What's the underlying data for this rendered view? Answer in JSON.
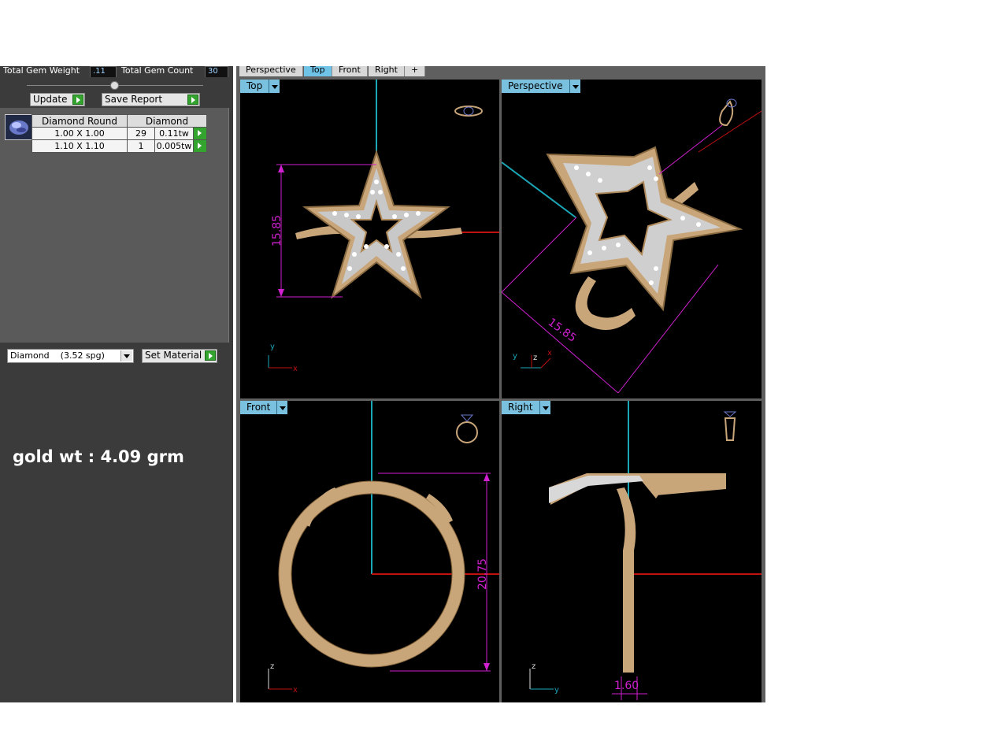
{
  "stats": {
    "total_gem_weight_label": "Total Gem Weight",
    "total_gem_weight_value": ".11",
    "total_gem_count_label": "Total Gem Count",
    "total_gem_count_value": "30"
  },
  "buttons": {
    "update": "Update",
    "save_report": "Save Report",
    "set_material": "Set Material"
  },
  "gem_table": {
    "headers": [
      "Diamond Round",
      "Diamond"
    ],
    "rows": [
      {
        "size": "1.00 X 1.00",
        "count": "29",
        "weight": "0.11tw"
      },
      {
        "size": "1.10 X 1.10",
        "count": "1",
        "weight": "0.005tw"
      }
    ]
  },
  "material_select": {
    "value": "Diamond    (3.52 spg)"
  },
  "note": "gold wt : 4.09 grm",
  "tabs": [
    "Perspective",
    "Top",
    "Front",
    "Right",
    "+"
  ],
  "active_tab": "Top",
  "viewports": {
    "top": {
      "label": "Top",
      "dimension": "15.85",
      "axis_1": "y",
      "axis_2": "x"
    },
    "perspective": {
      "label": "Perspective",
      "dimension": "15.85",
      "axis_1": "y",
      "axis_2": "z",
      "axis_3": "x"
    },
    "front": {
      "label": "Front",
      "dimension": "20.75",
      "axis_1": "z",
      "axis_2": "x"
    },
    "right": {
      "label": "Right",
      "dimension": "1.60",
      "axis_1": "z",
      "axis_2": "y"
    }
  },
  "colors": {
    "gold": "#c9a57a",
    "dimension": "#d020d0",
    "axis_cyan": "#1aa7b8",
    "axis_red": "#c01010",
    "label_blue": "#79c1df"
  }
}
